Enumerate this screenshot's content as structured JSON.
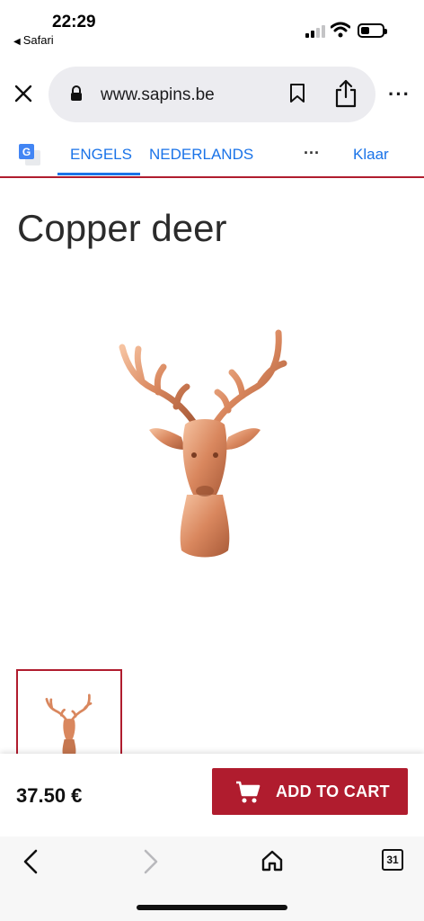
{
  "status_bar": {
    "time": "22:29",
    "back_app": "Safari"
  },
  "browser": {
    "url": "www.sapins.be",
    "icons": [
      "close-icon",
      "lock-icon",
      "bookmark-icon",
      "share-icon",
      "more-icon"
    ]
  },
  "translate_bar": {
    "tab_source": "ENGELS",
    "tab_target": "NEDERLANDS",
    "more": "···",
    "done": "Klaar"
  },
  "product": {
    "title": "Copper deer",
    "price": "37.50 €",
    "add_to_cart": "ADD TO CART"
  },
  "toolbar": {
    "tab_count": "31",
    "icons": [
      "back-icon",
      "forward-icon",
      "home-icon",
      "tabs-icon"
    ]
  },
  "colors": {
    "accent": "#b01c2e",
    "link": "#1a73e8",
    "copper": "#d9875e"
  }
}
